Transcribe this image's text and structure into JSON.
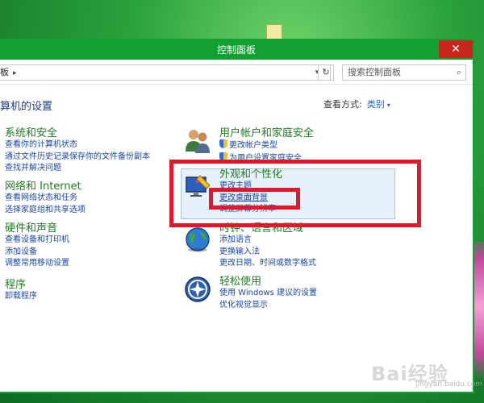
{
  "window": {
    "title": "控制面板",
    "close_glyph": "✕"
  },
  "address": {
    "crumb": "板",
    "crumb_arrow": "▸",
    "dropdown": "▾",
    "refresh": "↻",
    "search_placeholder": "搜索控制面板",
    "search_icon": "search-icon"
  },
  "header": {
    "page_title": "算机的设置",
    "view_label": "查看方式:",
    "view_value": "类别",
    "view_caret": "▾"
  },
  "categories_left": [
    {
      "title": "系统和安全",
      "links": [
        "查看你的计算机状态",
        "通过文件历史记录保存你的文件备份副本",
        "查找并解决问题"
      ]
    },
    {
      "title": "网络和 Internet",
      "links": [
        "查看网络状态和任务",
        "选择家庭组和共享选项"
      ]
    },
    {
      "title": "硬件和声音",
      "links": [
        "查看设备和打印机",
        "添加设备",
        "调整常用移动设置"
      ]
    },
    {
      "title": "程序",
      "links": [
        "卸载程序"
      ]
    }
  ],
  "categories_right": [
    {
      "title": "用户帐户和家庭安全",
      "links": [
        "更改帐户类型",
        "为用户设置家庭安全"
      ]
    },
    {
      "title": "外观和个性化",
      "links": [
        "更改主题",
        "更改桌面背景",
        "调整屏幕分辨率"
      ]
    },
    {
      "title": "时钟、语言和区域",
      "links": [
        "添加语言",
        "更换输入法",
        "更改日期、时间或数字格式"
      ]
    },
    {
      "title": "轻松使用",
      "links": [
        "使用 Windows 建议的设置",
        "优化视觉显示"
      ]
    }
  ],
  "watermark": {
    "text": "Bai经验",
    "sub": "jingyan.baidu.com"
  },
  "colors": {
    "accent_green": "#12a032",
    "close_red": "#c7281e",
    "link_blue": "#1b46a8",
    "title_green": "#1e7d20",
    "annotation_red": "#e0182a"
  }
}
